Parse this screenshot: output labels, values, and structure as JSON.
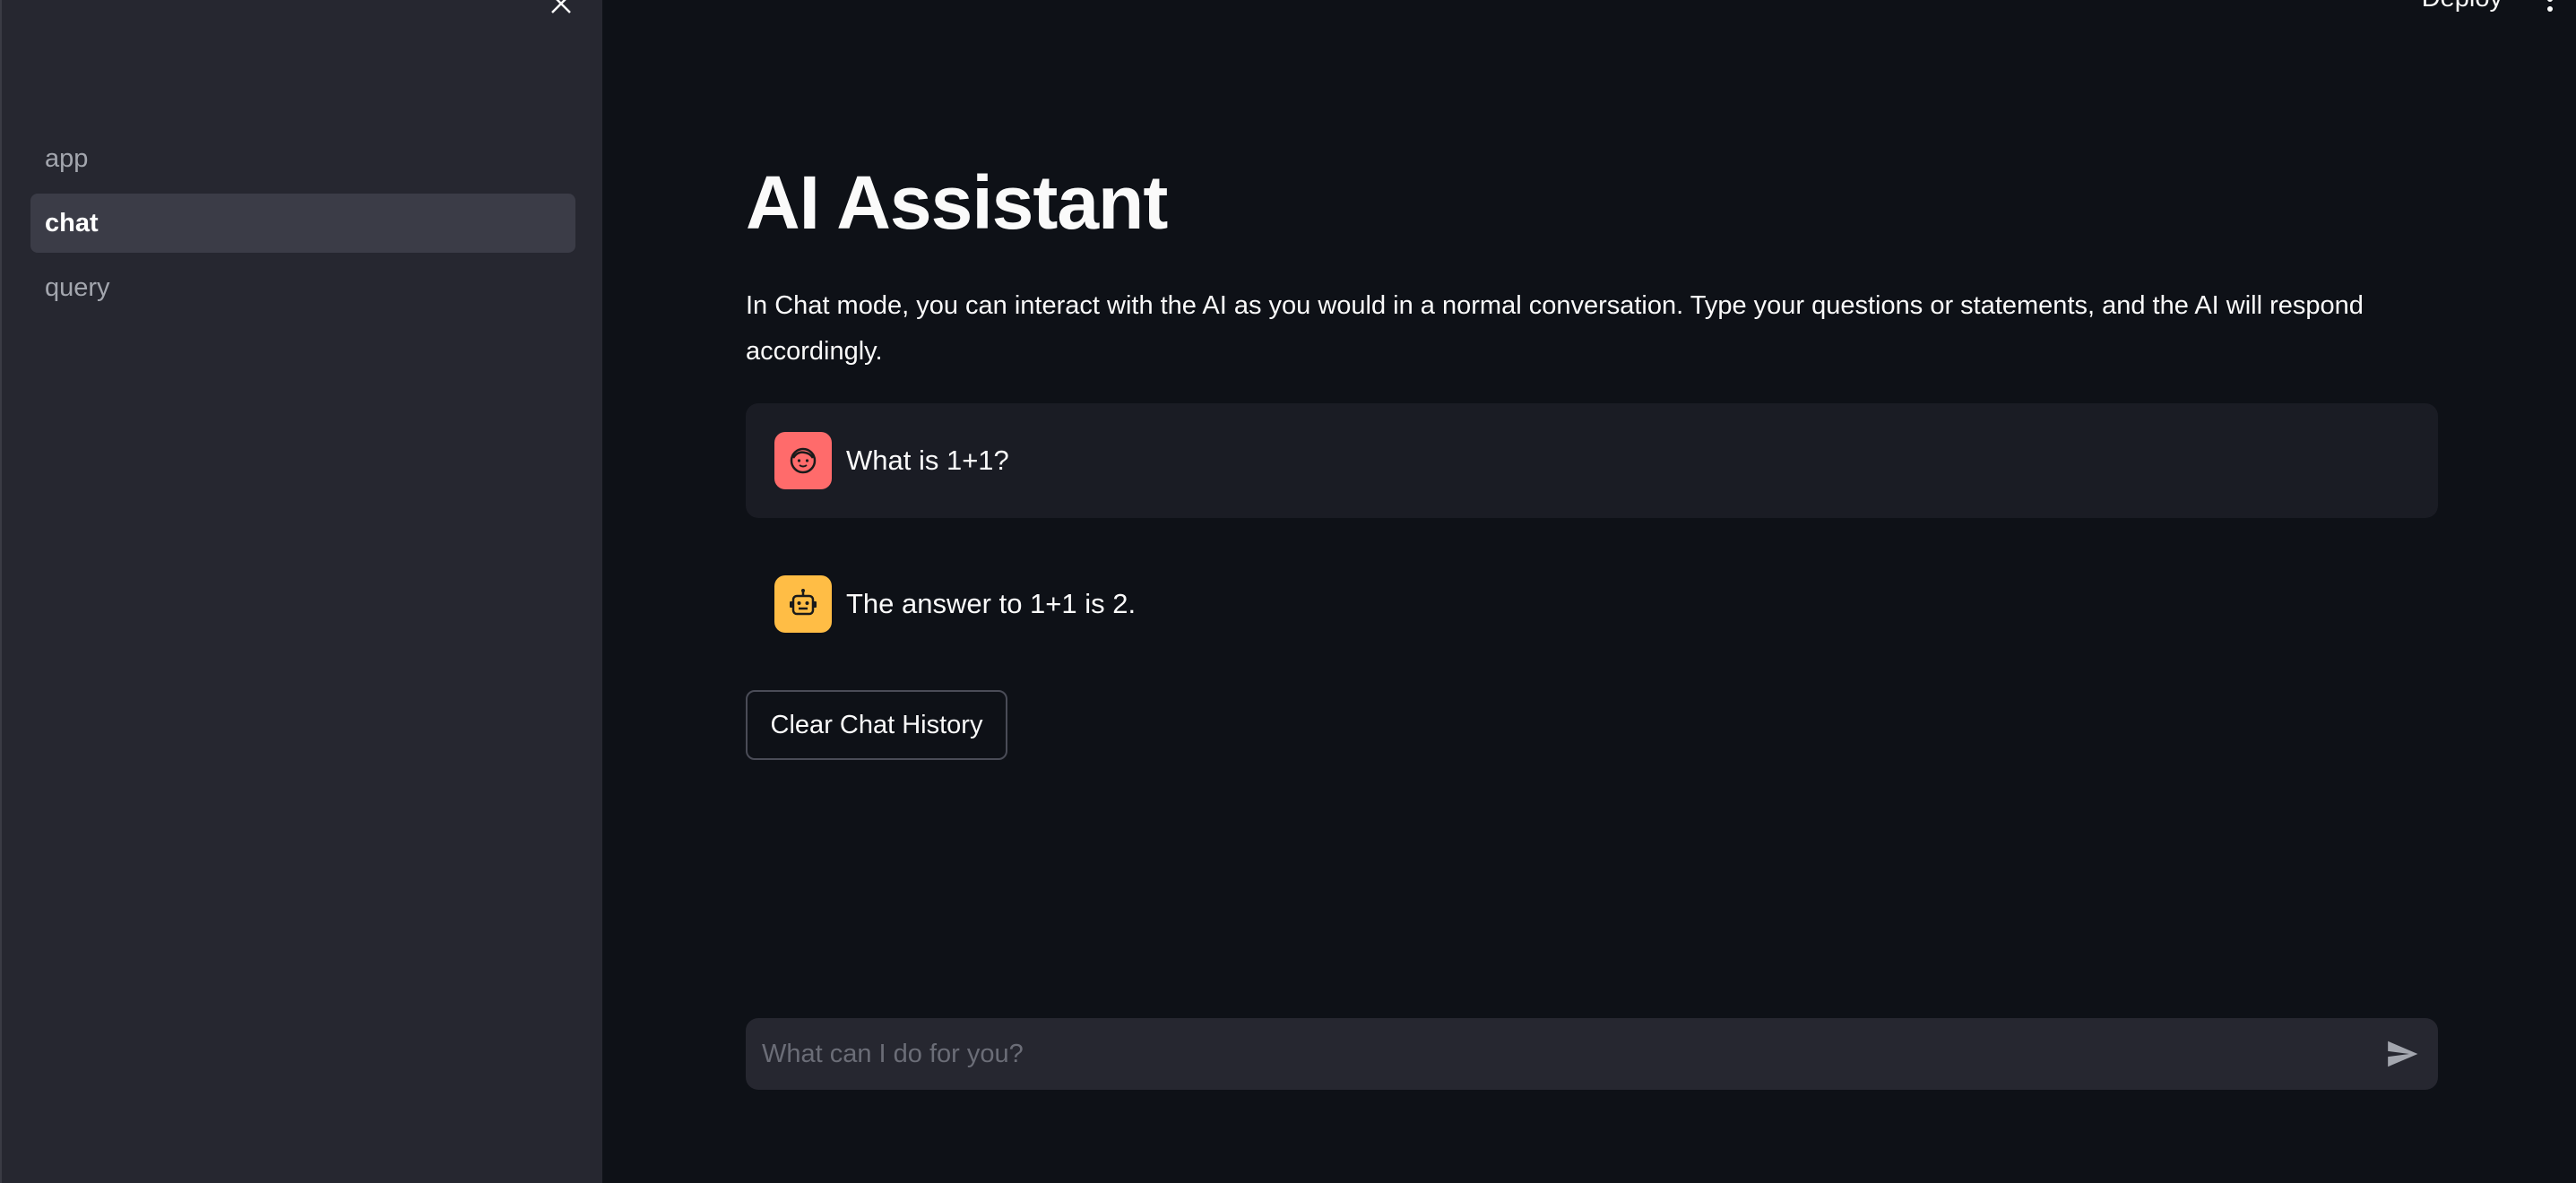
{
  "sidebar": {
    "close_icon": "close-icon",
    "items": [
      {
        "label": "app",
        "active": false
      },
      {
        "label": "chat",
        "active": true
      },
      {
        "label": "query",
        "active": false
      }
    ]
  },
  "header": {
    "deploy_label": "Deploy",
    "menu_icon": "vertical-dots-icon"
  },
  "main": {
    "title": "AI Assistant",
    "description": "In Chat mode, you can interact with the AI as you would in a normal conversation. Type your questions or statements, and the AI will respond accordingly.",
    "messages": [
      {
        "role": "user",
        "avatar_icon": "user-face-icon",
        "avatar_color": "#ff6b6b",
        "text": "What is 1+1?"
      },
      {
        "role": "assistant",
        "avatar_icon": "robot-icon",
        "avatar_color": "#ffbd45",
        "text": "The answer to 1+1 is 2."
      }
    ],
    "clear_button_label": "Clear Chat History"
  },
  "chat_input": {
    "placeholder": "What can I do for you?",
    "value": "",
    "send_icon": "send-icon"
  },
  "colors": {
    "background": "#0e1117",
    "sidebar": "#262730",
    "text": "#fafafa"
  }
}
